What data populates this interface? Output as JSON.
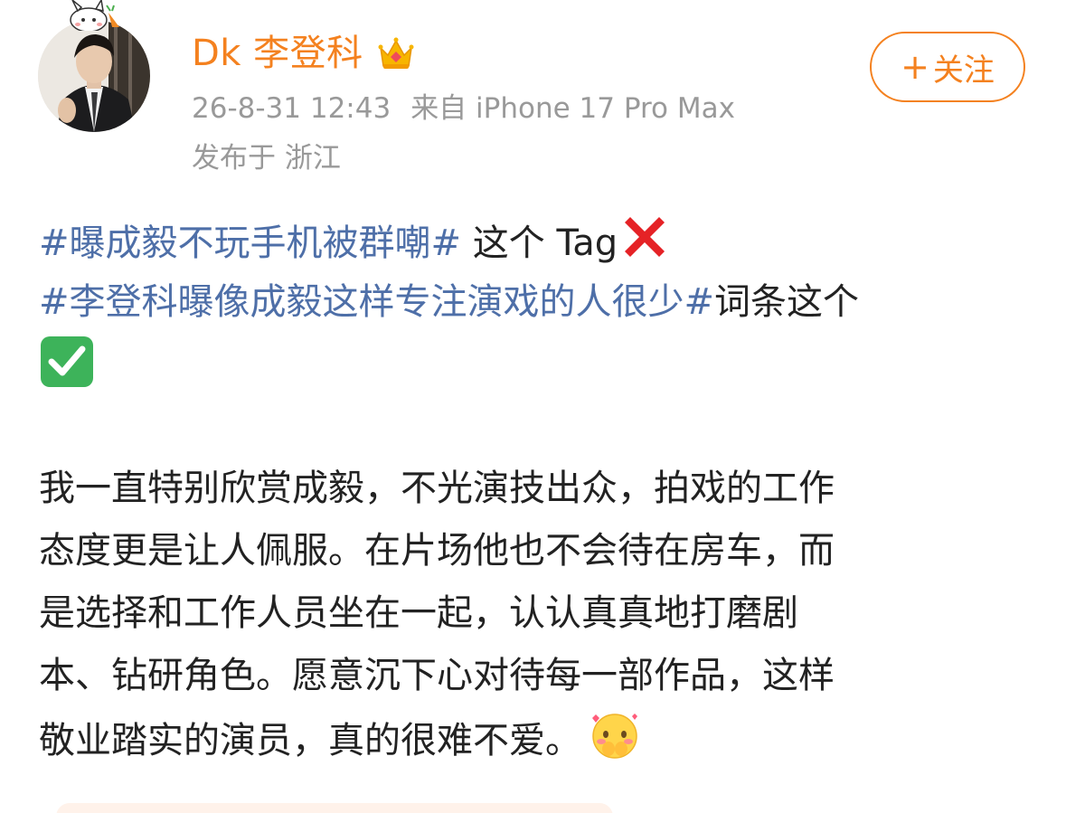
{
  "post": {
    "author": {
      "name": "Dk 李登科",
      "timestamp": "26-8-31 12:43",
      "source": "来自 iPhone 17 Pro Max",
      "location": "发布于 浙江"
    },
    "follow_button": {
      "icon": "+",
      "label": "关注"
    },
    "lines": [
      {
        "hashtag": "#曝成毅不玩手机被群嘲#",
        "text": " 这个 Tag",
        "emoji": "cross-mark"
      },
      {
        "hashtag": "#李登科曝像成毅这样专注演戏的人很少#",
        "text": "词条这个"
      },
      {
        "emoji": "check-mark"
      }
    ],
    "paragraph": [
      "我一直特别欣赏成毅，不光演技出众，拍戏的工作",
      "态度更是让人佩服。在片场他也不会待在房车，而",
      "是选择和工作人员坐在一起，认认真真地打磨剧",
      "本、钻研角色。愿意沉下心对待每一部作品，这样",
      "敬业踏实的演员，真的很难不爱。"
    ],
    "end_emoji": "blushing-face-emoji"
  },
  "colors": {
    "username": "#f4811f",
    "hashtag": "#4e6fa8",
    "meta": "#999999",
    "body": "#222222",
    "check": "#3db35a",
    "cross": "#e52226"
  }
}
